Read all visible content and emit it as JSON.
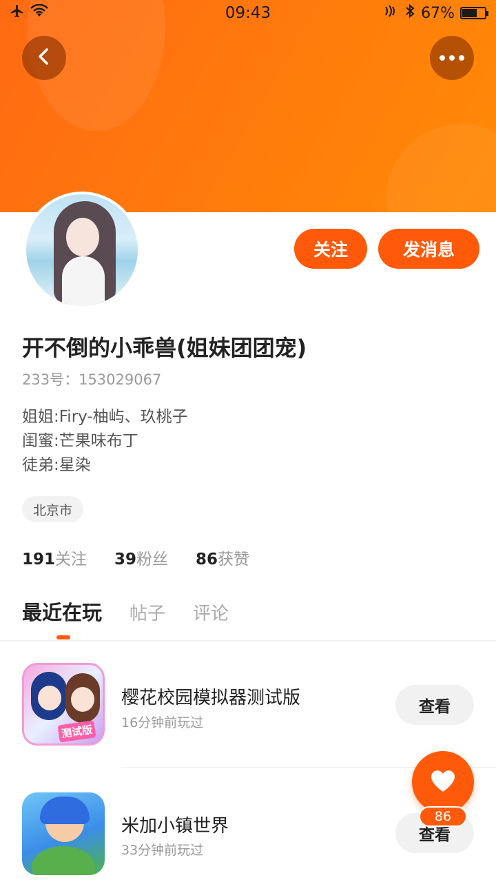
{
  "status_bar": {
    "time": "09:43",
    "battery": "67%",
    "battery_level": 0.67,
    "icons": [
      "airplane-icon",
      "wifi-icon",
      "nfc-icon",
      "bluetooth-icon",
      "battery-icon"
    ]
  },
  "header": {
    "back_icon": "chevron-left-icon",
    "more_icon": "more-dots-icon"
  },
  "profile": {
    "nickname": "开不倒的小乖兽(姐妹团团宠)",
    "uid": "233号：153029067",
    "bio": [
      "姐姐:Firy-柚屿、玖桃子",
      "闺蜜:芒果味布丁",
      "徒弟:星染"
    ],
    "location": "北京市",
    "follow_label": "关注",
    "message_label": "发消息"
  },
  "stats": [
    {
      "num": "191",
      "label": "关注"
    },
    {
      "num": "39",
      "label": "粉丝"
    },
    {
      "num": "86",
      "label": "获赞"
    }
  ],
  "tabs": [
    {
      "label": "最近在玩",
      "active": true
    },
    {
      "label": "帖子",
      "active": false
    },
    {
      "label": "评论",
      "active": false
    }
  ],
  "games": [
    {
      "name": "樱花校园模拟器测试版",
      "played": "16分钟前玩过",
      "button": "查看",
      "icon_tag": "测试版"
    },
    {
      "name": "米加小镇世界",
      "played": "33分钟前玩过",
      "button": "查看"
    }
  ],
  "floating": {
    "icon": "heart-icon",
    "count": "86"
  },
  "colors": {
    "accent": "#ff5a0a",
    "header_gradient_start": "#ff6a13",
    "header_gradient_end": "#ff8a06"
  }
}
